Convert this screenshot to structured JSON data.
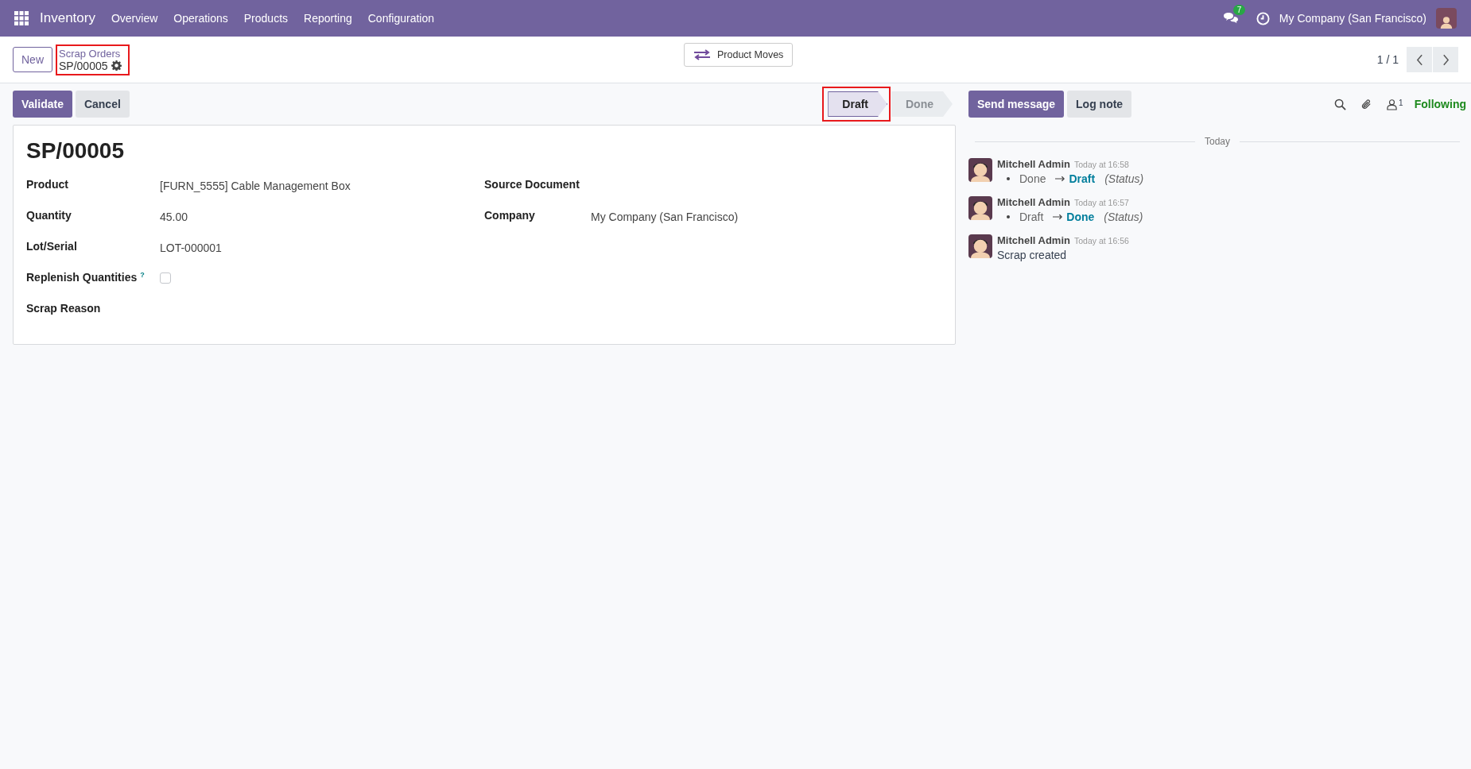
{
  "navbar": {
    "app": "Inventory",
    "menus": [
      "Overview",
      "Operations",
      "Products",
      "Reporting",
      "Configuration"
    ],
    "messages_badge": "7",
    "company": "My Company (San Francisco)"
  },
  "control_panel": {
    "new_button": "New",
    "breadcrumb": {
      "parent": "Scrap Orders",
      "current": "SP/00005",
      "highlighted": true
    },
    "smart_button": "Product Moves",
    "pager": "1 / 1"
  },
  "actions": [
    {
      "label": "Validate",
      "primary": true
    },
    {
      "label": "Cancel",
      "primary": false
    }
  ],
  "status": {
    "stages": [
      {
        "label": "Draft",
        "selected": true,
        "highlighted": true
      },
      {
        "label": "Done",
        "selected": false,
        "highlighted": false
      }
    ]
  },
  "form": {
    "title": "SP/00005",
    "left_fields": [
      {
        "label": "Product",
        "value": "[FURN_5555] Cable Management Box",
        "kind": "text"
      },
      {
        "label": "Quantity",
        "value": "45.00",
        "kind": "text"
      },
      {
        "label": "Lot/Serial",
        "value": "LOT-000001",
        "kind": "text"
      },
      {
        "label": "Replenish Quantities",
        "help": "?",
        "checked": false,
        "kind": "checkbox"
      },
      {
        "label": "Scrap Reason",
        "kind": "text"
      }
    ],
    "right_fields": [
      {
        "label": "Source Document",
        "kind": "text"
      },
      {
        "label": "Company",
        "value": "My Company (San Francisco)",
        "kind": "text"
      }
    ]
  },
  "chatter": {
    "send_message": "Send message",
    "log_note": "Log note",
    "followers_count": "1",
    "following": "Following",
    "date_separator": "Today",
    "messages": [
      {
        "author": "Mitchell Admin",
        "time": "Today at 16:58",
        "kind": "tracking",
        "old": "Done",
        "new": "Draft",
        "field": "(Status)"
      },
      {
        "author": "Mitchell Admin",
        "time": "Today at 16:57",
        "kind": "tracking",
        "old": "Draft",
        "new": "Done",
        "field": "(Status)"
      },
      {
        "author": "Mitchell Admin",
        "time": "Today at 16:56",
        "kind": "text",
        "body": "Scrap created"
      }
    ]
  }
}
